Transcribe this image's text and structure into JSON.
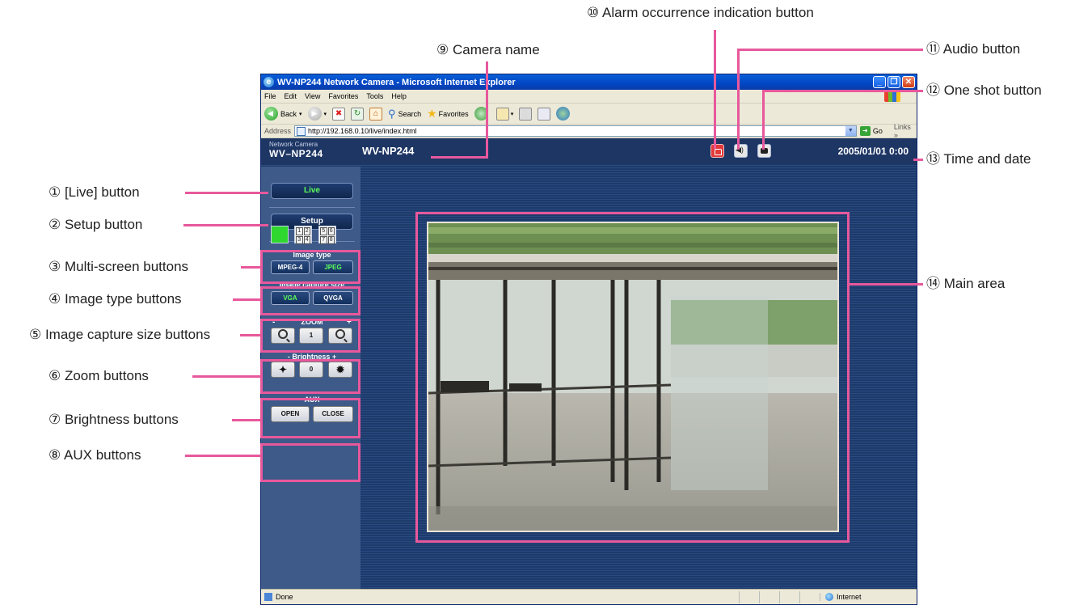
{
  "browser": {
    "title": "WV-NP244 Network Camera - Microsoft Internet Explorer",
    "menu": [
      "File",
      "Edit",
      "View",
      "Favorites",
      "Tools",
      "Help"
    ],
    "toolbar": {
      "back": "Back",
      "search": "Search",
      "favorites": "Favorites"
    },
    "address_label": "Address",
    "url": "http://192.168.0.10/live/index.html",
    "go": "Go",
    "links": "Links",
    "status_left": "Done",
    "status_zone": "Internet"
  },
  "camera": {
    "brand_small": "Network Camera",
    "brand_model": "WV–NP244",
    "name": "WV-NP244",
    "datetime": "2005/01/01  0:00"
  },
  "sidebar": {
    "live": "Live",
    "setup": "Setup",
    "multiscreen_4": [
      "1",
      "2",
      "3",
      "4"
    ],
    "multiscreen_8": [
      "5",
      "6",
      "7",
      "8"
    ],
    "image_type_title": "Image type",
    "image_type": [
      "MPEG-4",
      "JPEG"
    ],
    "capture_size_title": "Image capture size",
    "capture_size": [
      "VGA",
      "QVGA"
    ],
    "zoom_title": "ZOOM",
    "zoom_minus": "-",
    "zoom_plus": "+",
    "zoom_level": "1",
    "brightness_title": "- Brightness +",
    "brightness_level": "0",
    "aux_title": "AUX",
    "aux": [
      "OPEN",
      "CLOSE"
    ]
  },
  "callouts": {
    "live_button": "① [Live] button",
    "setup_button": "② Setup button",
    "multiscreen_buttons": "③ Multi-screen buttons",
    "image_type_buttons": "④ Image type buttons",
    "capture_size_buttons": "⑤ Image capture size buttons",
    "zoom_buttons": "⑥ Zoom buttons",
    "brightness_buttons": "⑦ Brightness buttons",
    "aux_buttons": "⑧ AUX buttons",
    "camera_name": "⑨ Camera name",
    "alarm_button": "⑩ Alarm occurrence indication button",
    "audio_button": "⑪ Audio button",
    "one_shot_button": "⑫ One shot button",
    "time_date": "⑬ Time and date",
    "main_area": "⑭ Main area"
  },
  "colors": {
    "callout": "#e8589c",
    "page_bg": "#1d3a6b",
    "sidebar_bg": "#3d5a88",
    "active_text": "#5cff5c"
  }
}
